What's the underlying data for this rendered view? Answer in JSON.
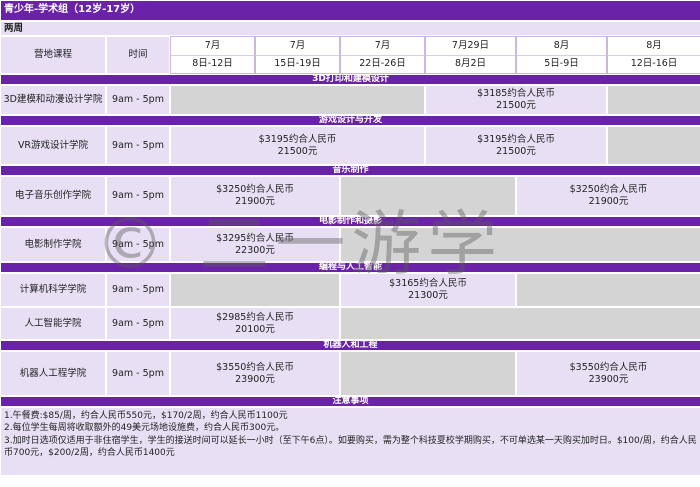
{
  "title": "青少年-学术组（12岁-17岁）",
  "duration": "两周",
  "headers": {
    "program": "营地课程",
    "time": "时间"
  },
  "dates": [
    {
      "month": "7月",
      "range": "8日-12日"
    },
    {
      "month": "7月",
      "range": "15日-19日"
    },
    {
      "month": "7月",
      "range": "22日-26日"
    },
    {
      "month": "7月29日",
      "range": "8月2日"
    },
    {
      "month": "8月",
      "range": "5日-9日"
    },
    {
      "month": "8月",
      "range": "12日-16日"
    }
  ],
  "sections": {
    "s1": "3D打印和建模设计",
    "s2": "游戏设计与开发",
    "s3": "音乐制作",
    "s4": "电影制作和摄影",
    "s5": "编程与人工智能",
    "s6": "机器人和工程",
    "notes": "注意事项"
  },
  "rows": {
    "r1": {
      "program": "3D建模和动漫设计学院",
      "time": "9am - 5pm",
      "p1": "$3185约合人民币",
      "p1b": "21500元"
    },
    "r2": {
      "program": "VR游戏设计学院",
      "time": "9am - 5pm",
      "p1": "$3195约合人民币",
      "p1b": "21500元",
      "p2": "$3195约合人民币",
      "p2b": "21500元"
    },
    "r3": {
      "program": "电子音乐创作学院",
      "time": "9am - 5pm",
      "p1": "$3250约合人民币",
      "p1b": "21900元",
      "p2": "$3250约合人民币",
      "p2b": "21900元"
    },
    "r4": {
      "program": "电影制作学院",
      "time": "9am - 5pm",
      "p1": "$3295约合人民币",
      "p1b": "22300元"
    },
    "r5": {
      "program": "计算机科学学院",
      "time": "9am - 5pm",
      "p1": "$3165约合人民币",
      "p1b": "21300元"
    },
    "r6": {
      "program": "人工智能学院",
      "time": "9am - 5pm",
      "p1": "$2985约合人民币",
      "p1b": "20100元"
    },
    "r7": {
      "program": "机器人工程学院",
      "time": "9am - 5pm",
      "p1": "$3550约合人民币",
      "p1b": "23900元",
      "p2": "$3550约合人民币",
      "p2b": "23900元"
    }
  },
  "notes": [
    "1.午餐费:$85/周，约合人民币550元，$170/2周，约合人民币1100元",
    "2.每位学生每周将收取额外的49美元场地设施费，约合人民币300元。",
    "3.加时日选项仅适用于非住宿学生，学生的接送时间可以延长一小时（至下午6点）。如要购买，需为整个科技夏校学期购买，不可单选某一天购买加时日。$100/周，约合人民币700元，$200/2周，约合人民币1400元"
  ],
  "watermark": "© 二一游学"
}
